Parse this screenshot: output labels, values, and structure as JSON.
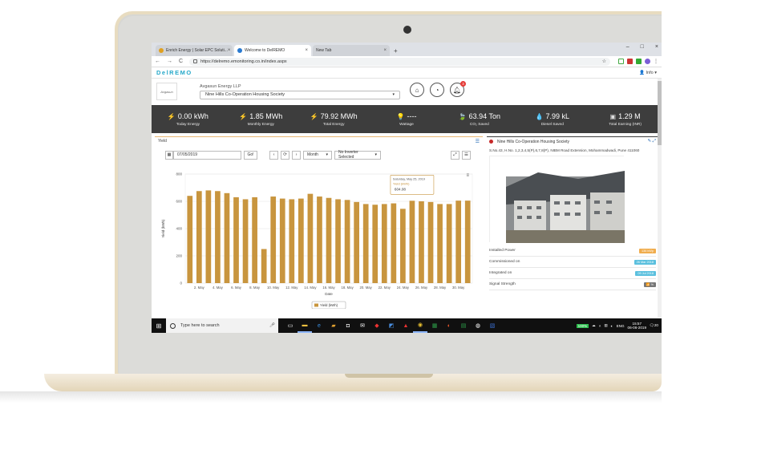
{
  "browser": {
    "tabs": [
      {
        "label": "Enrich Energy | Solar EPC Soluti...",
        "close": "×"
      },
      {
        "label": "Welcome to DelREMO",
        "close": "×"
      },
      {
        "label": "New Tab",
        "close": "×"
      }
    ],
    "new_tab": "+",
    "url": "https://delremo.emonitoring.co.in/index.aspx",
    "controls": {
      "minimize": "–",
      "maximize": "□",
      "close": "×"
    },
    "nav": {
      "back": "←",
      "forward": "→",
      "reload": "C"
    }
  },
  "app": {
    "brand": "DelREMO",
    "user_menu": "Info",
    "company": "Avgasun Energy LLP",
    "logo_text": "Avgasun",
    "site_select": "Nine Hills Co-Operation Housing Society",
    "notification_count": "3"
  },
  "kpis": [
    {
      "icon": "⚡",
      "value": "0.00 kWh",
      "label": "Today Energy"
    },
    {
      "icon": "⚡",
      "value": "1.85 MWh",
      "label": "Monthly Energy"
    },
    {
      "icon": "⚡",
      "value": "79.92 MWh",
      "label": "Total Energy"
    },
    {
      "icon": "💡",
      "value": "----",
      "label": "Wattage"
    },
    {
      "icon": "🍃",
      "value": "63.94 Ton",
      "label": "CO₂ Saved"
    },
    {
      "icon": "💧",
      "value": "7.99 kL",
      "label": "Diesel Saved"
    },
    {
      "icon": "▣",
      "value": "1.29 M",
      "label": "Total Earning (INR)"
    }
  ],
  "yield_panel": {
    "title": "Yield",
    "date": "07/05/2019",
    "go": "Go!",
    "period": "Month",
    "inverter": "No Inverter Selected"
  },
  "chart_data": {
    "type": "bar",
    "title": "",
    "xlabel": "Date",
    "ylabel": "Yield (kWh)",
    "ylim": [
      0,
      800
    ],
    "yticks": [
      0,
      200,
      400,
      600,
      800
    ],
    "categories": [
      "1. May",
      "2. May",
      "3. May",
      "4. May",
      "5. May",
      "6. May",
      "7. May",
      "8. May",
      "9. May",
      "10. May",
      "11. May",
      "12. May",
      "13. May",
      "14. May",
      "15. May",
      "16. May",
      "17. May",
      "18. May",
      "19. May",
      "20. May",
      "21. May",
      "22. May",
      "23. May",
      "24. May",
      "25. May",
      "26. May",
      "27. May",
      "28. May",
      "29. May",
      "30. May",
      "31. May"
    ],
    "tick_labels": [
      "2. May",
      "4. May",
      "6. May",
      "8. May",
      "10. May",
      "12. May",
      "14. May",
      "16. May",
      "18. May",
      "20. May",
      "22. May",
      "24. May",
      "26. May",
      "28. May",
      "30. May"
    ],
    "series": [
      {
        "name": "Yield (kWh)",
        "color": "#c8953e",
        "values": [
          640,
          675,
          680,
          675,
          660,
          630,
          615,
          630,
          250,
          635,
          620,
          615,
          620,
          655,
          635,
          625,
          615,
          610,
          595,
          580,
          575,
          580,
          585,
          545,
          604.08,
          600,
          595,
          580,
          580,
          605,
          605
        ]
      }
    ],
    "tooltip": {
      "date": "Saturday, May 25, 2019",
      "series": "Yield (kWh)",
      "value": "604.08"
    },
    "grid": true,
    "legend": "bottom"
  },
  "site_info": {
    "name": "Nine Hills Co-Operation Housing Society",
    "address": "S.No.43, H.No. 1,2,3,4,5(P),6,7,8(P), NIBM Road Extension, Mohammadwadi, Pune 411060",
    "rows": [
      {
        "label": "Installed Power",
        "value": "136 kWp",
        "color": "#f0ad4e"
      },
      {
        "label": "Commissioned on",
        "value": "26 Mar 2018",
        "color": "#5bc0de"
      },
      {
        "label": "Integrated on",
        "value": "09 Jul 2018",
        "color": "#5bc0de"
      },
      {
        "label": "Signal Strength",
        "value": "📶 %",
        "color": "#777777"
      }
    ]
  },
  "taskbar": {
    "search": "Type here to search",
    "battery": "100%",
    "lang": "ENG",
    "time": "15:57",
    "date": "06-06-2019",
    "notif": "20"
  }
}
